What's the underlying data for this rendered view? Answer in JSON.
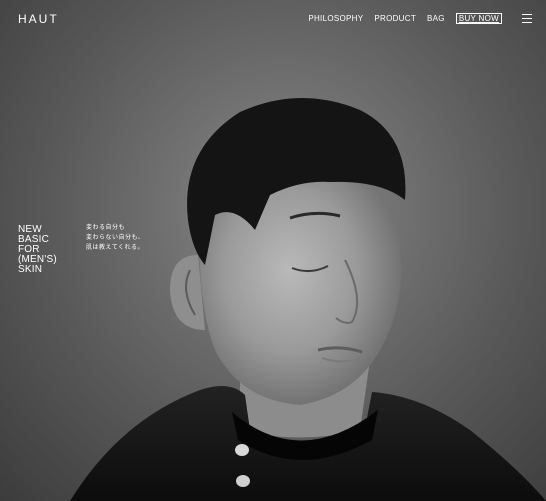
{
  "brand": {
    "logo": "HAUT"
  },
  "nav": {
    "items": [
      {
        "label": "PHILOSOPHY"
      },
      {
        "label": "PRODUCT"
      },
      {
        "label": "BAG"
      }
    ],
    "buy_label": "BUY NOW",
    "menu_icon": "hamburger-menu-icon"
  },
  "hero": {
    "tagline_lines": [
      "NEW",
      "BASIC",
      "FOR",
      "(MEN'S)",
      "SKIN"
    ],
    "jp_lines": [
      "変わる自分も",
      "変わらない自分も、",
      "肌は教えてくれる。"
    ],
    "image": "black-and-white portrait of man with closed eyes"
  }
}
